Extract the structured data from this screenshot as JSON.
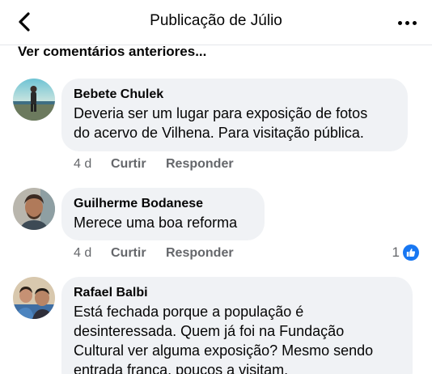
{
  "header": {
    "title": "Publicação de Júlio",
    "back_icon": "chevron-left-icon",
    "more_icon": "more-horizontal-icon"
  },
  "previous_comments_label": "Ver comentários anteriores...",
  "comments": [
    {
      "author": "Bebete Chulek",
      "lines": [
        "Deveria ser um lugar para exposição de fotos",
        "do acervo de Vilhena. Para visitação pública."
      ],
      "time": "4 d",
      "like_label": "Curtir",
      "reply_label": "Responder"
    },
    {
      "author": "Guilherme Bodanese",
      "lines": [
        "Merece uma boa reforma"
      ],
      "time": "4 d",
      "like_label": "Curtir",
      "reply_label": "Responder",
      "reaction_count": "1",
      "reaction_icon": "like-icon",
      "reaction_color": "#1877f2"
    },
    {
      "author": "Rafael Balbi",
      "lines": [
        "Está fechada porque a população é",
        "desinteressada. Quem já foi na Fundação",
        "Cultural ver alguma exposição? Mesmo sendo",
        "entrada franca, poucos a visitam."
      ]
    }
  ]
}
